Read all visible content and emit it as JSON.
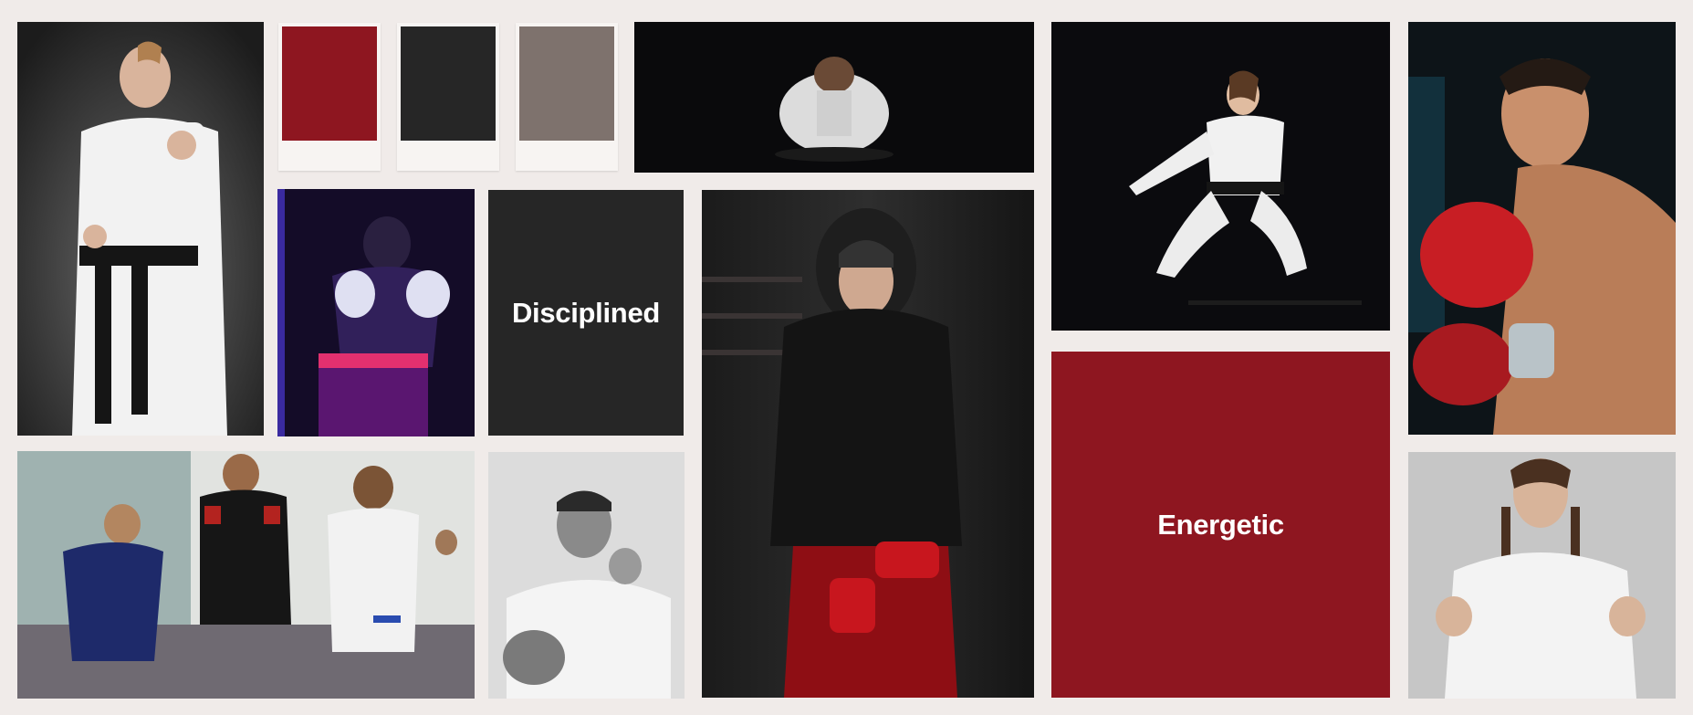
{
  "colors": {
    "page_background": "#f0ebe9",
    "brand_red": "#8e1620",
    "charcoal": "#262626",
    "taupe": "#7e726d"
  },
  "swatches": [
    {
      "name": "red",
      "color": "#8e1620"
    },
    {
      "name": "charcoal",
      "color": "#262626"
    },
    {
      "name": "taupe",
      "color": "#7e726d"
    }
  ],
  "mood_words": {
    "disciplined": "Disciplined",
    "energetic": "Energetic"
  },
  "photos": [
    {
      "name": "karate-woman-black-belt-photo",
      "subject": "woman in white gi with black belt, punching"
    },
    {
      "name": "kneeling-bow-photo",
      "subject": "martial artist kneeling and bowing"
    },
    {
      "name": "girl-kneeling-kata-photo",
      "subject": "girl in white gi kneeling in stance"
    },
    {
      "name": "boxer-red-gloves-photo",
      "subject": "shirtless boxer with red gloves"
    },
    {
      "name": "muay-thai-fighter-neon-photo",
      "subject": "fighter in neon light with gloves"
    },
    {
      "name": "hooded-boxer-photo",
      "subject": "man in black hoodie with red hand wraps"
    },
    {
      "name": "kids-class-instructor-photo",
      "subject": "instructor with children in gi"
    },
    {
      "name": "man-punch-bw-photo",
      "subject": "man in gi punching, black and white"
    },
    {
      "name": "woman-braids-gi-photo",
      "subject": "woman with braids in white gi"
    }
  ]
}
